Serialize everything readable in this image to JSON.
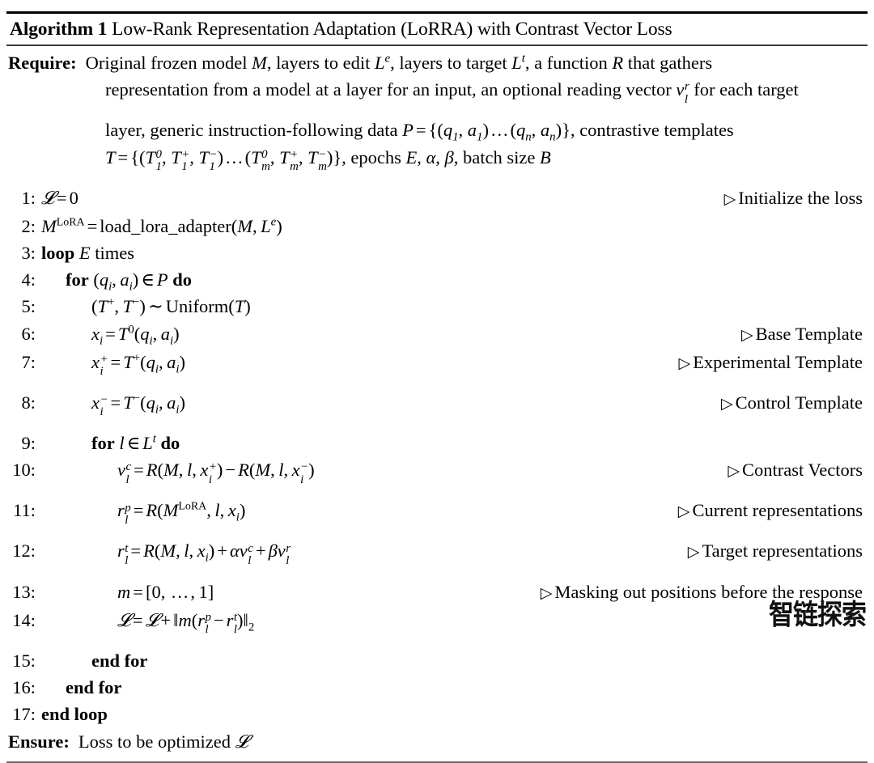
{
  "document": {
    "type": "algorithm-pseudocode",
    "caption": {
      "label": "Algorithm 1",
      "title": "Low-Rank Representation Adaptation (LoRRA) with Contrast Vector Loss"
    },
    "require": {
      "keyword": "Require:",
      "lines": [
        "Original frozen model M, layers to edit Le, layers to target Lt, a function R that gathers",
        "representation from a model at a layer for an input, an optional reading vector vlr for each target",
        "layer, generic instruction-following data P = {(q1, a1) ... (qn, an)}, contrastive templates",
        "T = {(T10, T1+, T1-) ... (Tm0, Tm+, Tm-)}, epochs E, α, β, batch size B"
      ]
    },
    "ensure": {
      "keyword": "Ensure:",
      "text": "Loss to be optimized L"
    },
    "steps": [
      {
        "num": "1:",
        "indent": 0,
        "code": "L = 0",
        "comment": "Initialize the loss"
      },
      {
        "num": "2:",
        "indent": 0,
        "code": "M^LoRA = load_lora_adapter(M, L^e)",
        "comment": ""
      },
      {
        "num": "3:",
        "indent": 0,
        "code": "loop E times",
        "comment": ""
      },
      {
        "num": "4:",
        "indent": 1,
        "code": "for (q_i, a_i) ∈ P do",
        "comment": ""
      },
      {
        "num": "5:",
        "indent": 2,
        "code": "(T+, T-) ~ Uniform(T)",
        "comment": ""
      },
      {
        "num": "6:",
        "indent": 2,
        "code": "x_i = T^0(q_i, a_i)",
        "comment": "Base Template"
      },
      {
        "num": "7:",
        "indent": 2,
        "code": "x_i^+ = T^+(q_i, a_i)",
        "comment": "Experimental Template"
      },
      {
        "num": "8:",
        "indent": 2,
        "code": "x_i^- = T^-(q_i, a_i)",
        "comment": "Control Template"
      },
      {
        "num": "9:",
        "indent": 2,
        "code": "for l ∈ L^t do",
        "comment": ""
      },
      {
        "num": "10:",
        "indent": 3,
        "code": "v_l^c = R(M, l, x_i^+) - R(M, l, x_i^-)",
        "comment": "Contrast Vectors"
      },
      {
        "num": "11:",
        "indent": 3,
        "code": "r_l^p = R(M^LoRA, l, x_i)",
        "comment": "Current representations"
      },
      {
        "num": "12:",
        "indent": 3,
        "code": "r_l^t = R(M, l, x_i) + αv_l^c + βv_l^r",
        "comment": "Target representations"
      },
      {
        "num": "13:",
        "indent": 3,
        "code": "m = [0, …, 1]",
        "comment": "Masking out positions before the response"
      },
      {
        "num": "14:",
        "indent": 3,
        "code": "L = L + ||m(r_l^p - r_l^t)||_2",
        "comment": ""
      },
      {
        "num": "15:",
        "indent": 2,
        "code": "end for",
        "comment": ""
      },
      {
        "num": "16:",
        "indent": 1,
        "code": "end for",
        "comment": ""
      },
      {
        "num": "17:",
        "indent": 0,
        "code": "end loop",
        "comment": ""
      }
    ],
    "comments": {
      "c1": "Initialize the loss",
      "c6": "Base Template",
      "c7": "Experimental Template",
      "c8": "Control Template",
      "c10": "Contrast Vectors",
      "c11": "Current representations",
      "c12": "Target representations",
      "c13": "Masking out positions before the response"
    },
    "line_numbers": {
      "n1": "1:",
      "n2": "2:",
      "n3": "3:",
      "n4": "4:",
      "n5": "5:",
      "n6": "6:",
      "n7": "7:",
      "n8": "8:",
      "n9": "9:",
      "n10": "10:",
      "n11": "11:",
      "n12": "12:",
      "n13": "13:",
      "n14": "14:",
      "n15": "15:",
      "n16": "16:",
      "n17": "17:"
    },
    "keywords": {
      "loop": "loop",
      "times": "times",
      "for": "for",
      "do": "do",
      "end_for": "end for",
      "end_loop": "end loop"
    },
    "watermark": "智链探索",
    "colors": {
      "text": "#000000",
      "rule_top": "#000000",
      "rule_mid": "#3a3a3a",
      "rule_bottom": "#6a6a6a",
      "background": "#ffffff"
    }
  }
}
